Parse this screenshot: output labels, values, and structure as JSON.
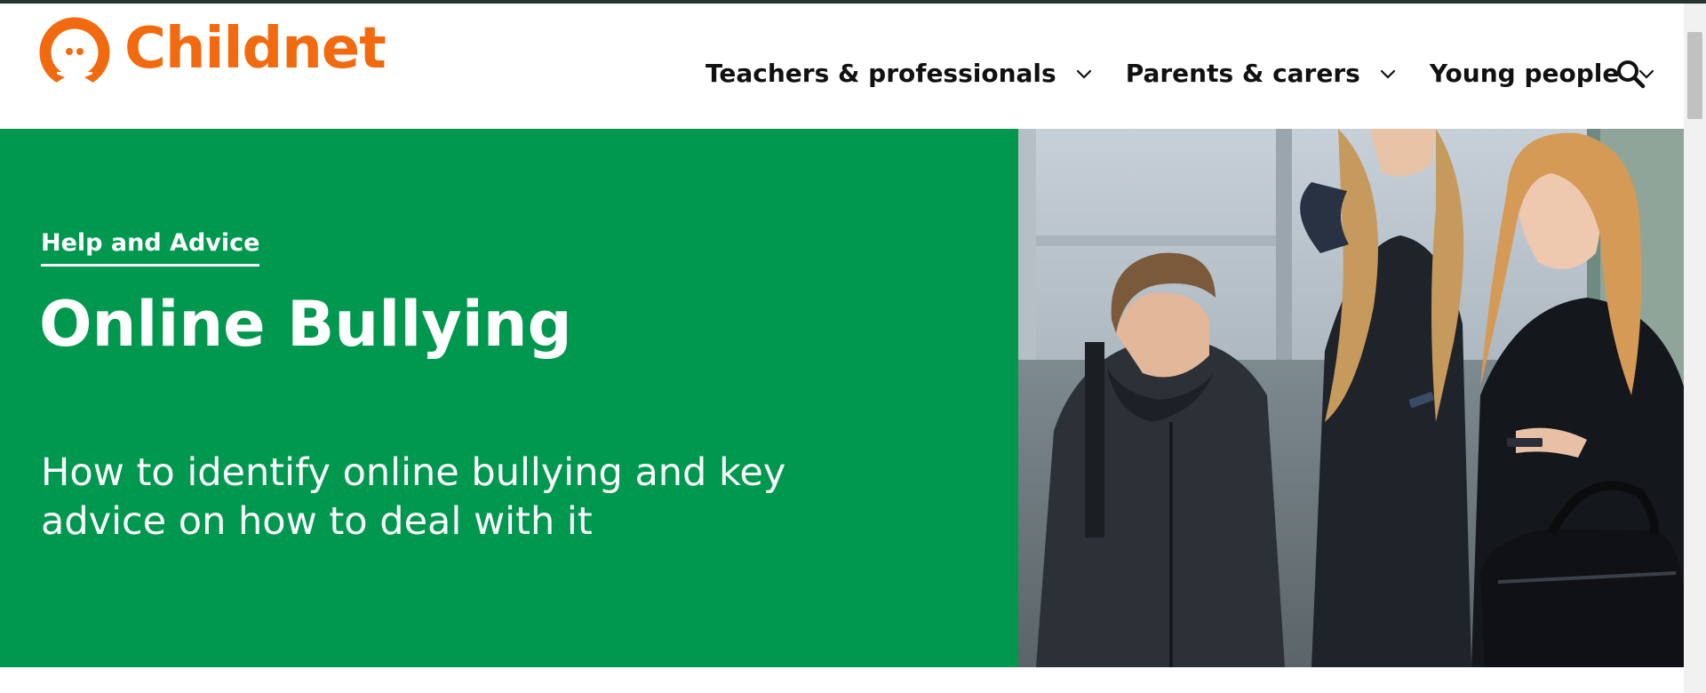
{
  "site": {
    "brand": "Childnet",
    "brand_color": "#f26a10",
    "logo_icon": "childnet-speech-face-logo"
  },
  "nav": {
    "items": [
      {
        "label": "Teachers & professionals",
        "icon": "chevron-down-icon"
      },
      {
        "label": "Parents & carers",
        "icon": "chevron-down-icon"
      },
      {
        "label": "Young people",
        "icon": "chevron-down-icon"
      }
    ],
    "search_icon": "search-icon"
  },
  "hero": {
    "eyebrow": "Help and Advice",
    "title": "Online Bullying",
    "lead": "How to identify online bullying and key advice on how to deal with it",
    "background_color": "#00984e",
    "photo": "students-outdoors-with-phones"
  }
}
